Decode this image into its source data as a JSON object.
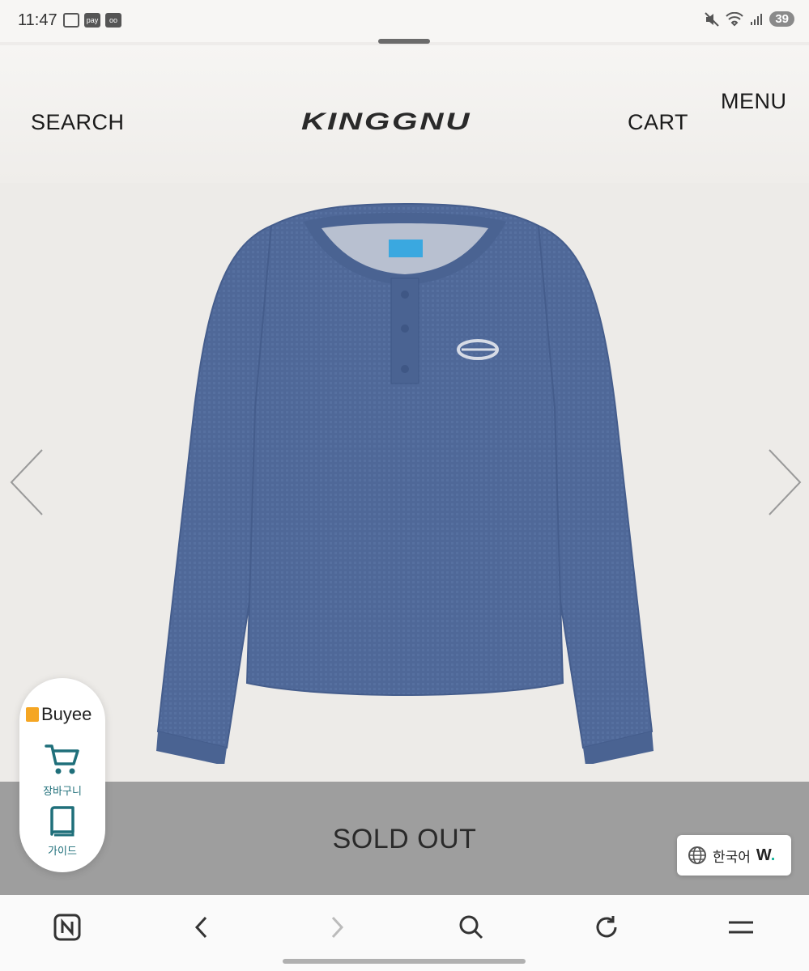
{
  "status_bar": {
    "time": "11:47",
    "pay_label": "pay",
    "battery": "39"
  },
  "header": {
    "search_label": "SEARCH",
    "logo_text": "KINGGNU",
    "cart_label": "CART",
    "menu_label": "MENU"
  },
  "product": {
    "image_icon": "blue-waffle-henley-longsleeve",
    "prev_icon": "chevron-left-icon",
    "next_icon": "chevron-right-icon"
  },
  "sold_out": {
    "label": "SOLD OUT"
  },
  "buyee_widget": {
    "logo_text": "Buyee",
    "cart_label": "장바구니",
    "guide_label": "가이드"
  },
  "language": {
    "label": "한국어",
    "brand": "W",
    "brand_dot": "."
  },
  "colors": {
    "sold_out_bg": "#9e9e9e",
    "product_blue": "#4f6898",
    "buyee_accent": "#1f6f7a"
  }
}
